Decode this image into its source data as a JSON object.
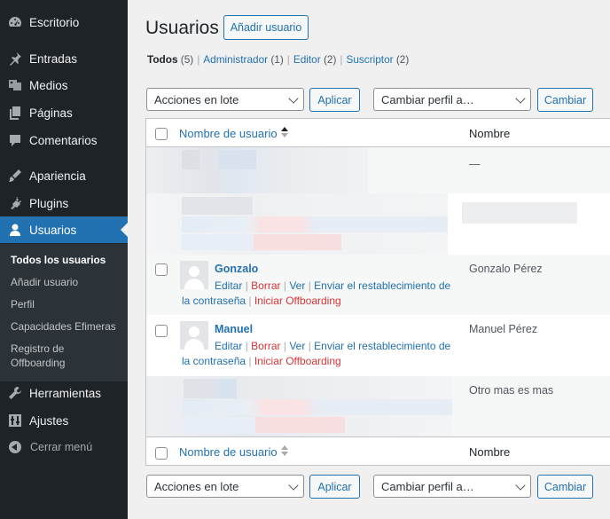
{
  "sidebar": {
    "items": [
      {
        "label": "Escritorio",
        "icon": "dashboard-icon"
      },
      {
        "label": "Entradas",
        "icon": "pin-icon"
      },
      {
        "label": "Medios",
        "icon": "media-icon"
      },
      {
        "label": "Páginas",
        "icon": "pages-icon"
      },
      {
        "label": "Comentarios",
        "icon": "comments-icon"
      },
      {
        "label": "Apariencia",
        "icon": "appearance-icon"
      },
      {
        "label": "Plugins",
        "icon": "plugins-icon"
      },
      {
        "label": "Usuarios",
        "icon": "users-icon"
      },
      {
        "label": "Herramientas",
        "icon": "tools-icon"
      },
      {
        "label": "Ajustes",
        "icon": "settings-icon"
      }
    ],
    "submenu": [
      "Todos los usuarios",
      "Añadir usuario",
      "Perfil",
      "Capacidades Efimeras",
      "Registro de Offboarding"
    ],
    "collapse_label": "Cerrar menú"
  },
  "header": {
    "title": "Usuarios",
    "add_button": "Añadir usuario"
  },
  "views": {
    "all": {
      "label": "Todos",
      "count": "(5)"
    },
    "admin": {
      "label": "Administrador",
      "count": "(1)"
    },
    "editor": {
      "label": "Editor",
      "count": "(2)"
    },
    "subscriber": {
      "label": "Suscriptor",
      "count": "(2)"
    }
  },
  "bulk": {
    "actions_select": "Acciones en lote",
    "apply": "Aplicar",
    "role_select": "Cambiar perfil a…",
    "change": "Cambiar"
  },
  "table": {
    "col_username": "Nombre de usuario",
    "col_name": "Nombre",
    "rows": [
      {
        "username": "",
        "name": "—",
        "redacted": true
      },
      {
        "username": "",
        "name": "",
        "redacted": true
      },
      {
        "username": "Gonzalo",
        "name": "Gonzalo Pérez"
      },
      {
        "username": "Manuel",
        "name": "Manuel Pérez"
      },
      {
        "username": "",
        "name": "Otro mas es mas",
        "redacted": true
      }
    ],
    "row_actions": {
      "edit": "Editar",
      "delete": "Borrar",
      "view": "Ver",
      "reset": "Enviar el restablecimiento de",
      "reset2": "la contraseña",
      "offboard": "Iniciar Offboarding",
      "sep": "|"
    }
  },
  "colors": {
    "sidebar_bg": "#1d2327",
    "accent": "#2271b1",
    "danger": "#d63638"
  }
}
